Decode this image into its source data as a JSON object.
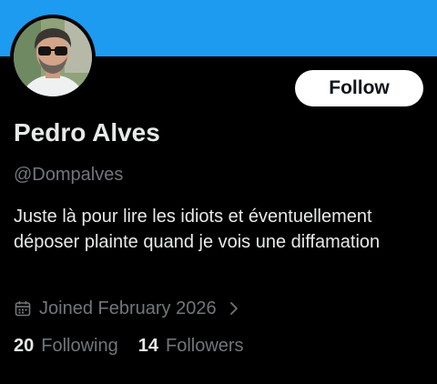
{
  "profile": {
    "name": "Pedro Alves",
    "handle": "@Dompalves",
    "bio": "Juste là pour lire les idiots et éventuellement déposer plainte quand je vois une diffamation",
    "joined": "Joined February 2026",
    "following_count": "20",
    "following_label": "Following",
    "followers_count": "14",
    "followers_label": "Followers"
  },
  "actions": {
    "follow_label": "Follow"
  },
  "colors": {
    "banner": "#1d9bf0",
    "background": "#000000",
    "primary_text": "#e7e9ea",
    "secondary_text": "#71767b",
    "button_bg": "#ffffff"
  },
  "icons": {
    "joined": "calendar-icon",
    "joined_more": "chevron-right-icon"
  }
}
